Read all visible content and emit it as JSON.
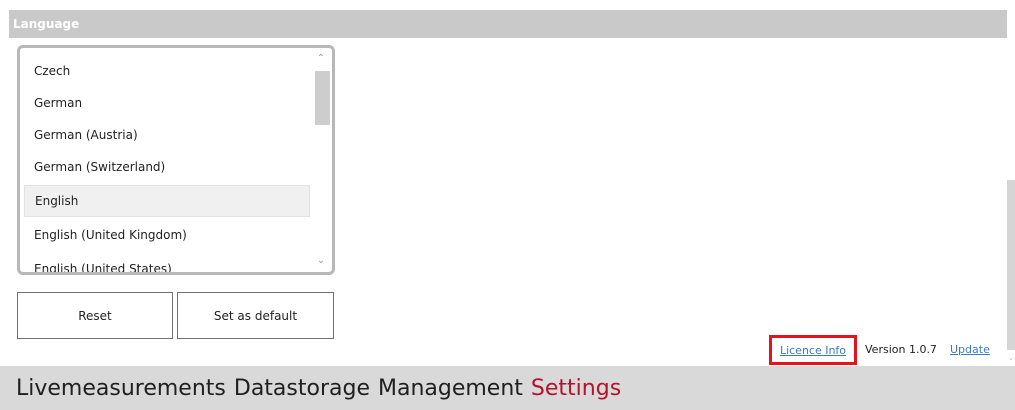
{
  "panel": {
    "title": "Language"
  },
  "language_list": {
    "items": [
      "Czech",
      "German",
      "German (Austria)",
      "German (Switzerland)",
      "English",
      "English (United Kingdom)",
      "English (United States)"
    ],
    "selected": "English"
  },
  "buttons": {
    "reset": "Reset",
    "set_default": "Set as default"
  },
  "footer": {
    "licence_info": "Licence Info",
    "version": "Version 1.0.7",
    "update": "Update"
  },
  "nav": {
    "items": [
      {
        "label": "Livemeasurements"
      },
      {
        "label": "Datastorage"
      },
      {
        "label": "Management"
      },
      {
        "label": "Settings",
        "active": true
      }
    ]
  },
  "colors": {
    "accent": "#b2122c",
    "link": "#3a7abf",
    "highlight_box": "#e3141c",
    "header_bg": "#c9c9c9"
  }
}
